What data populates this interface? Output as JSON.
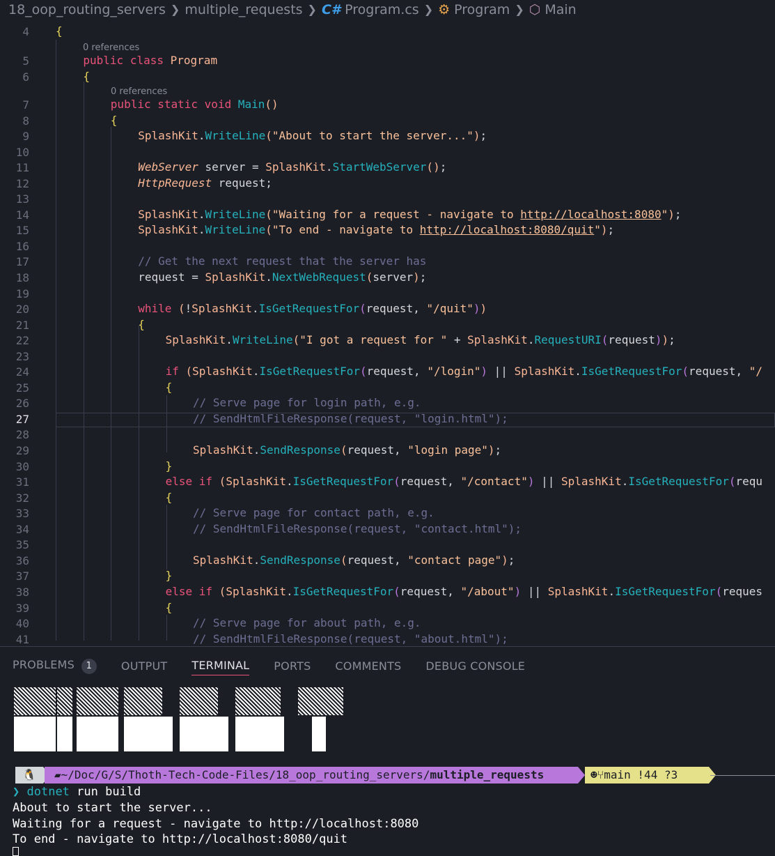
{
  "breadcrumb": {
    "folder": "18_oop_routing_servers",
    "subfolder": "multiple_requests",
    "file": "Program.cs",
    "class": "Program",
    "method": "Main"
  },
  "editor": {
    "active_line": 27,
    "codelens": [
      "0 references",
      "0 references"
    ],
    "lines": [
      {
        "n": 4,
        "text": "{"
      },
      {
        "n": 5,
        "text": "public class Program"
      },
      {
        "n": 6,
        "text": "{"
      },
      {
        "n": 7,
        "text": "public static void Main()"
      },
      {
        "n": 8,
        "text": "{"
      },
      {
        "n": 9,
        "text": "SplashKit.WriteLine(\"About to start the server...\");"
      },
      {
        "n": 10,
        "text": ""
      },
      {
        "n": 11,
        "text": "WebServer server = SplashKit.StartWebServer();"
      },
      {
        "n": 12,
        "text": "HttpRequest request;"
      },
      {
        "n": 13,
        "text": ""
      },
      {
        "n": 14,
        "text": "SplashKit.WriteLine(\"Waiting for a request - navigate to http://localhost:8080\");"
      },
      {
        "n": 15,
        "text": "SplashKit.WriteLine(\"To end - navigate to http://localhost:8080/quit\");"
      },
      {
        "n": 16,
        "text": ""
      },
      {
        "n": 17,
        "text": "// Get the next request that the server has"
      },
      {
        "n": 18,
        "text": "request = SplashKit.NextWebRequest(server);"
      },
      {
        "n": 19,
        "text": ""
      },
      {
        "n": 20,
        "text": "while (!SplashKit.IsGetRequestFor(request, \"/quit\"))"
      },
      {
        "n": 21,
        "text": "{"
      },
      {
        "n": 22,
        "text": "SplashKit.WriteLine(\"I got a request for \" + SplashKit.RequestURI(request));"
      },
      {
        "n": 23,
        "text": ""
      },
      {
        "n": 24,
        "text": "if (SplashKit.IsGetRequestFor(request, \"/login\") || SplashKit.IsGetRequestFor(request, \"/"
      },
      {
        "n": 25,
        "text": "{"
      },
      {
        "n": 26,
        "text": "// Serve page for login path, e.g."
      },
      {
        "n": 27,
        "text": "// SendHtmlFileResponse(request, \"login.html\");"
      },
      {
        "n": 28,
        "text": ""
      },
      {
        "n": 29,
        "text": "SplashKit.SendResponse(request, \"login page\");"
      },
      {
        "n": 30,
        "text": "}"
      },
      {
        "n": 31,
        "text": "else if (SplashKit.IsGetRequestFor(request, \"/contact\") || SplashKit.IsGetRequestFor(requ"
      },
      {
        "n": 32,
        "text": "{"
      },
      {
        "n": 33,
        "text": "// Serve page for contact path, e.g."
      },
      {
        "n": 34,
        "text": "// SendHtmlFileResponse(request, \"contact.html\");"
      },
      {
        "n": 35,
        "text": ""
      },
      {
        "n": 36,
        "text": "SplashKit.SendResponse(request, \"contact page\");"
      },
      {
        "n": 37,
        "text": "}"
      },
      {
        "n": 38,
        "text": "else if (SplashKit.IsGetRequestFor(request, \"/about\") || SplashKit.IsGetRequestFor(reques"
      },
      {
        "n": 39,
        "text": "{"
      },
      {
        "n": 40,
        "text": "// Serve page for about path, e.g."
      },
      {
        "n": 41,
        "text": "// SendHtmlFileResponse(request, \"about.html\");"
      }
    ]
  },
  "panel": {
    "tabs": [
      {
        "label": "PROBLEMS",
        "badge": "1"
      },
      {
        "label": "OUTPUT"
      },
      {
        "label": "TERMINAL",
        "active": true
      },
      {
        "label": "PORTS"
      },
      {
        "label": "COMMENTS"
      },
      {
        "label": "DEBUG CONSOLE"
      }
    ]
  },
  "terminal": {
    "path_prefix": "~/Doc/G/S/Thoth-Tech-Code-Files/18_oop_routing_servers/",
    "path_current": "multiple_requests",
    "git_branch": "main",
    "git_status": "!44 ?3",
    "prompt_symbol": "❯",
    "command": "dotnet",
    "command_args": "run build",
    "output": [
      "About to start the server...",
      "Waiting for a request - navigate to http://localhost:8080",
      "To end - navigate to http://localhost:8080/quit"
    ]
  },
  "colors": {
    "background": "#1c1e26",
    "keyword": "#e95379",
    "method": "#25b2bc",
    "string": "#fac29a",
    "comment": "#6c6f93",
    "active_tab_border": "#e95379",
    "path_segment": "#b877db",
    "git_segment": "#e5e08a"
  }
}
